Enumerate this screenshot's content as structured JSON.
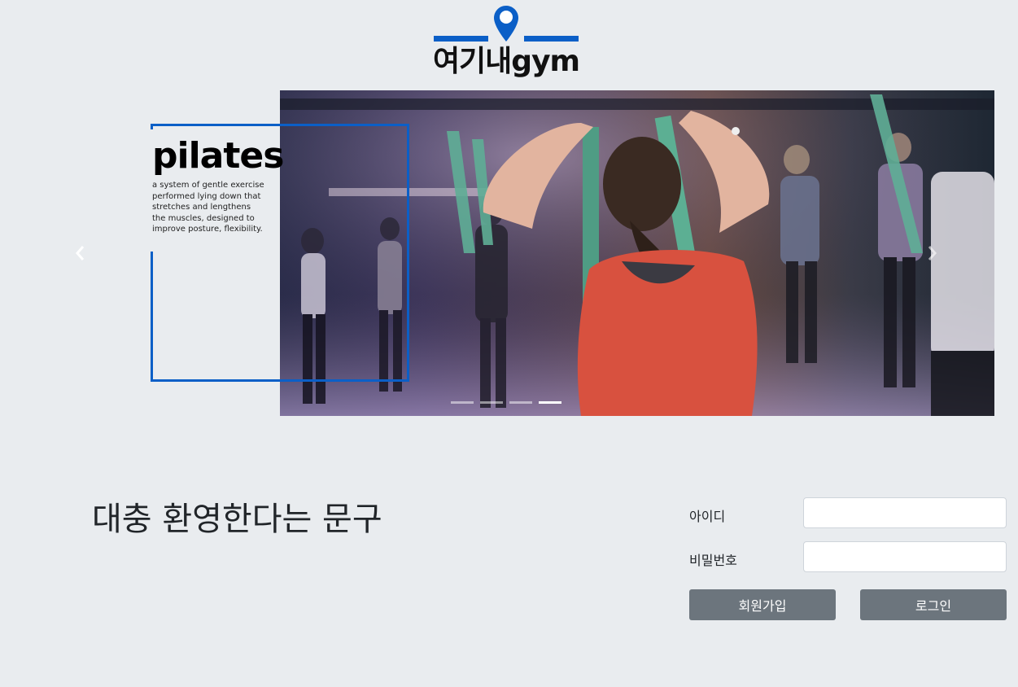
{
  "brand": {
    "logo_text": "여기내gym",
    "accent_color": "#0b5fc7"
  },
  "carousel": {
    "slide_title": "pilates",
    "slide_desc_lines": [
      "a system of gentle exercise",
      "performed lying down that",
      "stretches and lengthens",
      "the muscles, designed to",
      "improve posture, flexibility."
    ],
    "prev_icon": "chevron-left-icon",
    "next_icon": "chevron-right-icon",
    "slide_count": 4,
    "active_slide": 4
  },
  "welcome_text": "대충 환영한다는 문구",
  "login": {
    "id_label": "아이디",
    "id_value": "",
    "password_label": "비밀번호",
    "password_value": "",
    "signup_label": "회원가입",
    "login_label": "로그인"
  }
}
